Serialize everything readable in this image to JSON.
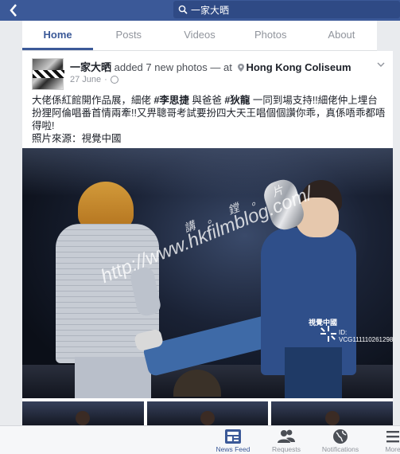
{
  "search": {
    "query": "一家大晒"
  },
  "tabs": [
    {
      "label": "Home",
      "active": true
    },
    {
      "label": "Posts"
    },
    {
      "label": "Videos"
    },
    {
      "label": "Photos"
    },
    {
      "label": "About"
    }
  ],
  "post": {
    "page_name": "一家大晒",
    "action": "added 7 new photos — at",
    "location": "Hong Kong Coliseum",
    "date": "27 June",
    "body_line1_pre": "大佬係紅館開作品展，細佬 ",
    "tag1": "#李思捷",
    "body_line1_mid": " 與爸爸 ",
    "tag2": "#狄龍",
    "body_line1_post": " 一同到場支持!!細佬仲上埋台扮狸阿倫唱番首情兩牽!!又畀聰哥考試要扮四大天王唱個個讚你乖，真係唔乖都唔得啦!",
    "body_line2": "照片來源：視覺中國",
    "watermark_url": "http://www.hkfilmblog.com/",
    "watermark_cn": "講 。 鏜 。 片",
    "vcg_logo": "視覺中國",
    "vcg_id": "ID: VCG111110261298"
  },
  "bottom_nav": [
    {
      "label": "News Feed",
      "icon": "news-feed-icon",
      "active": true
    },
    {
      "label": "Requests",
      "icon": "friend-requests-icon"
    },
    {
      "label": "Notifications",
      "icon": "globe-notifications-icon"
    },
    {
      "label": "More",
      "icon": "menu-icon"
    }
  ],
  "colors": {
    "brand": "#3b5998",
    "background": "#e9ebee"
  }
}
